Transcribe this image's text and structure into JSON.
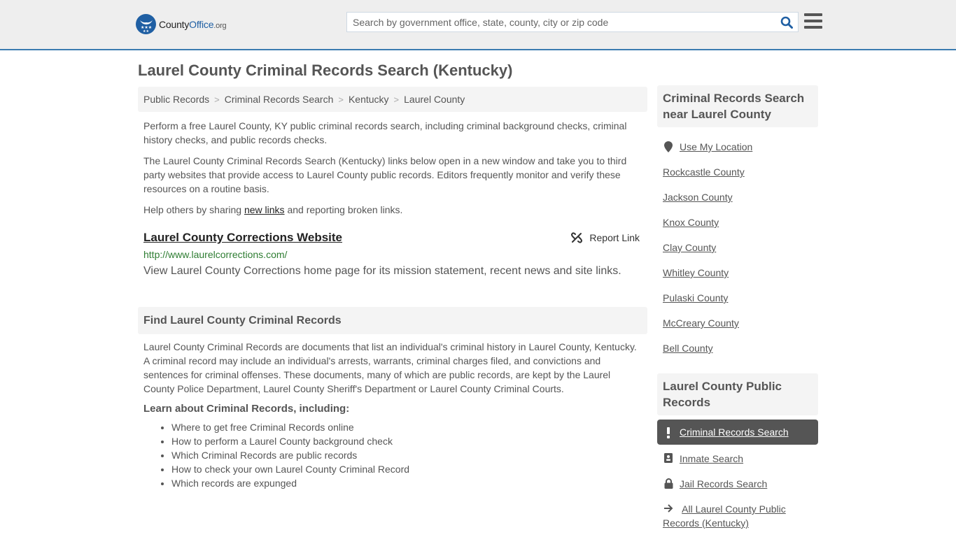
{
  "header": {
    "logo": {
      "part1": "County",
      "part2": "Office",
      "part3": ".org"
    },
    "search": {
      "placeholder": "Search by government office, state, county, city or zip code",
      "value": ""
    },
    "search_icon": "search-icon",
    "menu_icon": "hamburger-menu-icon"
  },
  "page": {
    "title": "Laurel County Criminal Records Search (Kentucky)"
  },
  "breadcrumb": [
    {
      "label": "Public Records"
    },
    {
      "label": "Criminal Records Search"
    },
    {
      "label": "Kentucky"
    },
    {
      "label": "Laurel County"
    }
  ],
  "breadcrumb_separator": ">",
  "intro": {
    "p1": "Perform a free Laurel County, KY public criminal records search, including criminal background checks, criminal history checks, and public records checks.",
    "p2": "The Laurel County Criminal Records Search (Kentucky) links below open in a new window and take you to third party websites that provide access to Laurel County public records. Editors frequently monitor and verify these resources on a routine basis.",
    "p3_before": "Help others by sharing ",
    "p3_link": "new links",
    "p3_after": " and reporting broken links."
  },
  "links": [
    {
      "title": "Laurel County Corrections Website",
      "url": "http://www.laurelcorrections.com/",
      "description": "View Laurel County Corrections home page for its mission statement, recent news and site links.",
      "report_label": "Report Link"
    }
  ],
  "find_section": {
    "heading": "Find Laurel County Criminal Records",
    "body": "Laurel County Criminal Records are documents that list an individual's criminal history in Laurel County, Kentucky. A criminal record may include an individual's arrests, warrants, criminal charges filed, and convictions and sentences for criminal offenses. These documents, many of which are public records, are kept by the Laurel County Police Department, Laurel County Sheriff's Department or Laurel County Criminal Courts.",
    "learn_heading": "Learn about Criminal Records, including:",
    "learn_items": [
      "Where to get free Criminal Records online",
      "How to perform a Laurel County background check",
      "Which Criminal Records are public records",
      "How to check your own Laurel County Criminal Record",
      "Which records are expunged"
    ]
  },
  "sidebar": {
    "nearby_heading": "Criminal Records Search near Laurel County",
    "use_location": "Use My Location",
    "nearby": [
      "Rockcastle County",
      "Jackson County",
      "Knox County",
      "Clay County",
      "Whitley County",
      "Pulaski County",
      "McCreary County",
      "Bell County"
    ],
    "public_heading": "Laurel County Public Records",
    "public_items": [
      {
        "label": "Criminal Records Search",
        "icon": "exclamation-icon",
        "active": true
      },
      {
        "label": "Inmate Search",
        "icon": "id-badge-icon",
        "active": false
      },
      {
        "label": "Jail Records Search",
        "icon": "lock-icon",
        "active": false
      },
      {
        "label": "All Laurel County Public Records (Kentucky)",
        "icon": "arrow-right-icon",
        "active": false
      }
    ]
  },
  "colors": {
    "brand_blue": "#1f5fa3",
    "header_border": "#3a7bb0",
    "url_green": "#2e7d32",
    "active_bg": "#555555"
  }
}
